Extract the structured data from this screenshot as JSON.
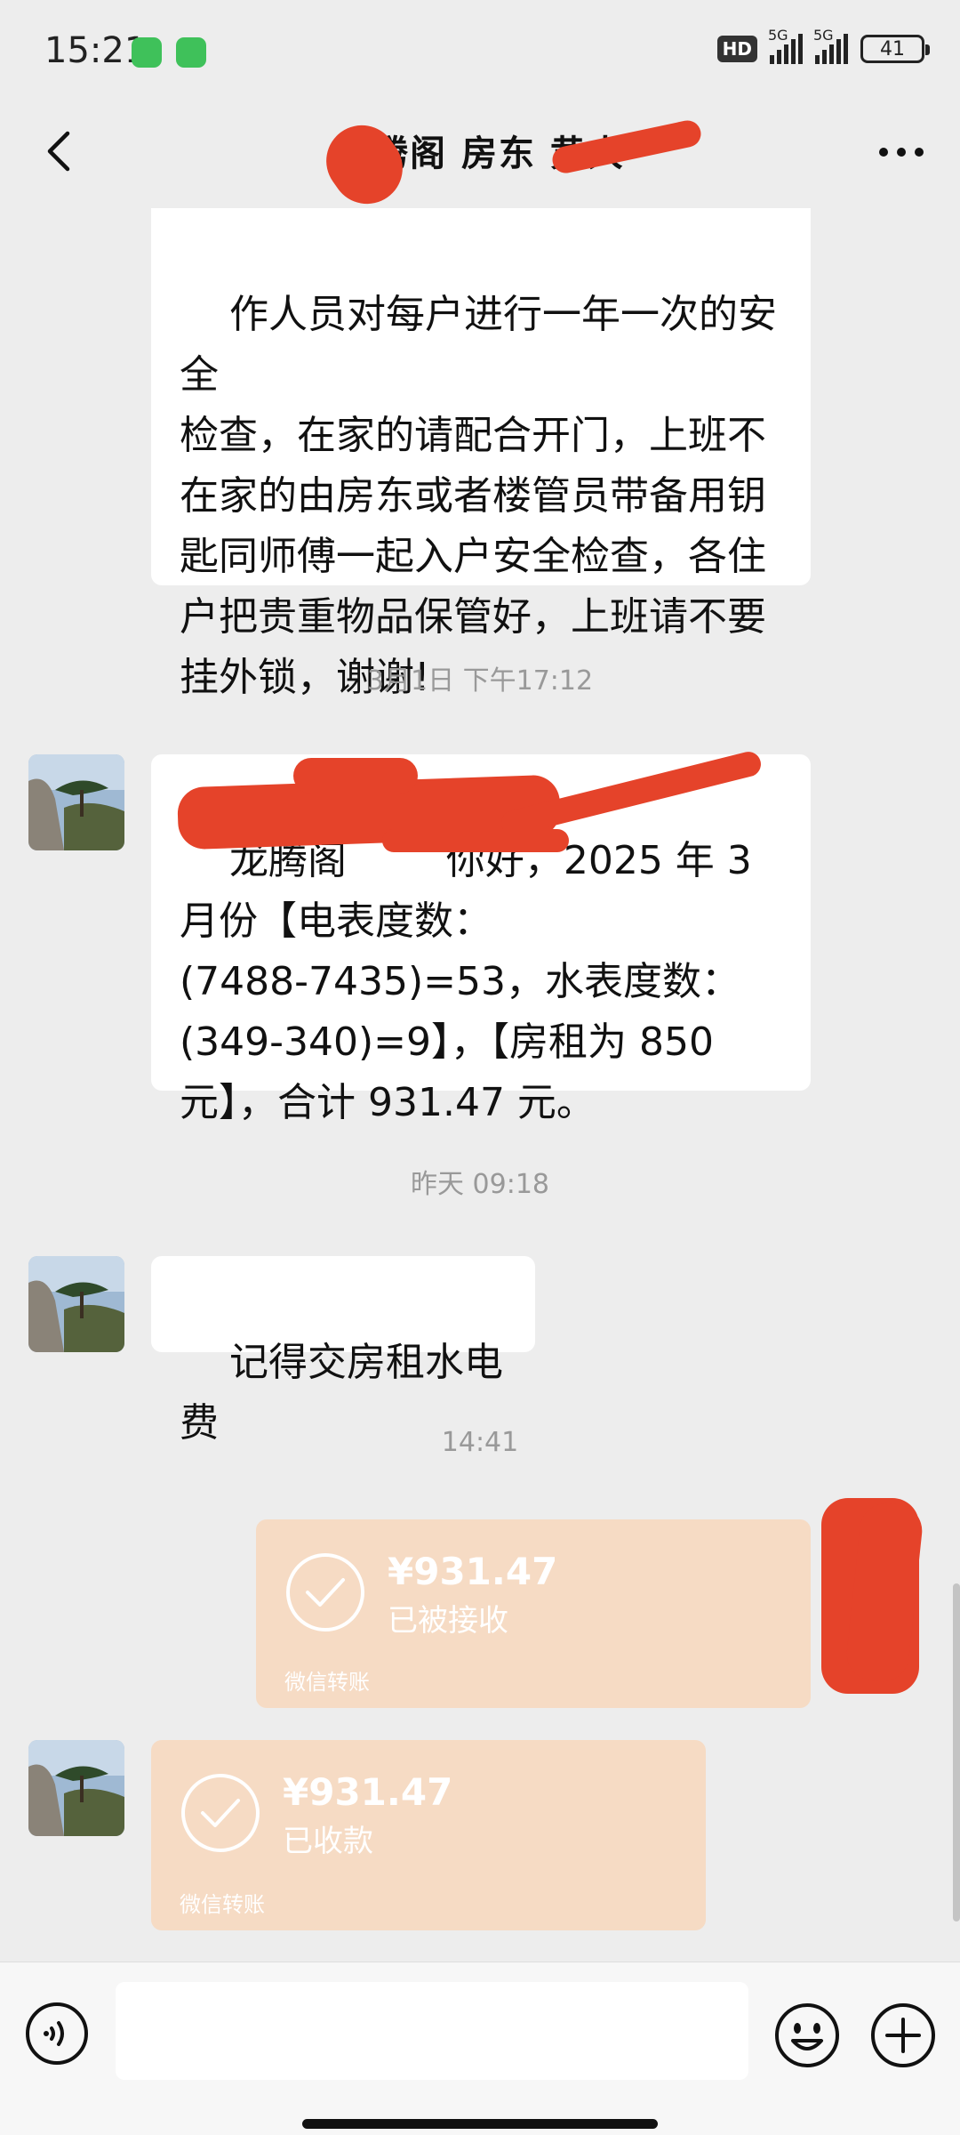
{
  "status_bar": {
    "time": "15:21",
    "hd_label": "HD",
    "network_1": "5G",
    "network_2": "5G",
    "battery": "41"
  },
  "nav": {
    "title": "龙腾阁 房东 黄大"
  },
  "messages": [
    {
      "type": "text",
      "sender": "other",
      "text": "作人员对每户进行一年一次的安全\n检查，在家的请配合开门，上班不\n在家的由房东或者楼管员带备用钥\n匙同师傅一起入户安全检查，各住\n户把贵重物品保管好，上班请不要\n挂外锁，谢谢!"
    },
    {
      "type": "timestamp",
      "text": "3月1日 下午17:12"
    },
    {
      "type": "text",
      "sender": "other",
      "text": "龙腾阁        你好，2025 年 3\n月份【电表度数：\n(7488-7435)=53，水表度数：\n(349-340)=9】，【房租为 850\n元】，合计 931.47 元。"
    },
    {
      "type": "timestamp",
      "text": "昨天 09:18"
    },
    {
      "type": "text",
      "sender": "other",
      "text": "记得交房租水电费"
    },
    {
      "type": "timestamp",
      "text": "14:41"
    },
    {
      "type": "transfer",
      "sender": "me",
      "amount": "¥931.47",
      "status": "已被接收",
      "footer": "微信转账"
    },
    {
      "type": "transfer",
      "sender": "other",
      "amount": "¥931.47",
      "status": "已收款",
      "footer": "微信转账"
    }
  ],
  "colors": {
    "background": "#ededed",
    "bubble": "#ffffff",
    "transfer_done": "#f6dbc4",
    "redaction": "#e5432a",
    "wechat_green": "#3fc15a"
  },
  "icons": {
    "back": "back-chevron-icon",
    "more": "more-dots-icon",
    "voice": "voice-icon",
    "emoji": "emoji-icon",
    "plus": "plus-icon",
    "check": "check-circle-icon"
  }
}
